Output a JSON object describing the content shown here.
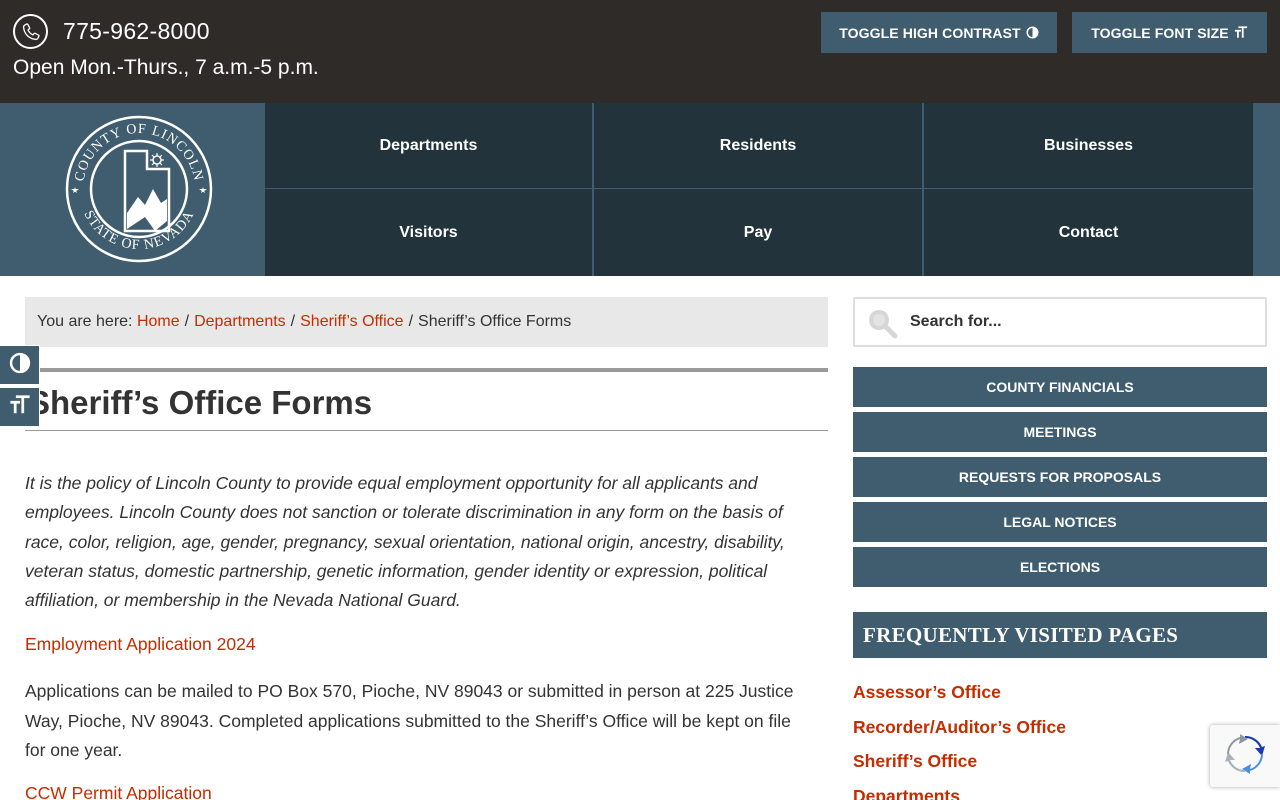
{
  "topbar": {
    "phone": "775-962-8000",
    "hours": "Open Mon.-Thurs., 7 a.m.-5 p.m.",
    "contrast_label": "TOGGLE HIGH CONTRAST",
    "font_label": "TOGGLE FONT SIZE"
  },
  "logo": {
    "top_text": "COUNTY OF LINCOLN",
    "bottom_text": "STATE OF NEVADA"
  },
  "nav": {
    "items": [
      {
        "label": "Departments"
      },
      {
        "label": "Residents"
      },
      {
        "label": "Businesses"
      },
      {
        "label": "Visitors"
      },
      {
        "label": "Pay"
      },
      {
        "label": "Contact"
      }
    ]
  },
  "breadcrumb": {
    "prefix": "You are here:",
    "links": [
      "Home",
      "Departments",
      "Sheriff’s Office"
    ],
    "current": "Sheriff’s Office Forms",
    "separator": "/"
  },
  "page": {
    "title": "Sheriff’s Office Forms",
    "policy": "It is the policy of Lincoln County to provide equal employment opportunity for all applicants and employees.  Lincoln County does not sanction or tolerate discrimination in any form on the basis of race, color, religion, age, gender, pregnancy, sexual orientation, national origin, ancestry, disability, veteran status, domestic partnership, genetic information, gender identity or expression, political affiliation, or membership in the Nevada National Guard.",
    "employment_link": "Employment Application 2024",
    "mail_text": "Applications can be mailed to PO Box 570, Pioche, NV 89043 or submitted in person at 225 Justice Way, Pioche, NV 89043.  Completed applications submitted to the Sheriff’s Office will be kept on file for one year.",
    "ccw_link": "CCW Permit Application"
  },
  "sidebar": {
    "search_placeholder": "Search for...",
    "buttons": [
      "COUNTY FINANCIALS",
      "MEETINGS",
      "REQUESTS FOR PROPOSALS",
      "LEGAL NOTICES",
      "ELECTIONS"
    ],
    "freq_title": "FREQUENTLY VISITED PAGES",
    "freq_items": [
      "Assessor’s Office",
      "Recorder/Auditor’s Office",
      "Sheriff’s Office",
      "Departments"
    ]
  },
  "colors": {
    "topbar_bg": "#2e2b29",
    "accent": "#3f5d6e",
    "nav_bg": "#22333c",
    "link": "#c52d00"
  },
  "icons": {
    "phone": "phone-icon",
    "contrast": "contrast-icon",
    "font_size": "font-size-icon",
    "search": "search-icon",
    "recaptcha": "recaptcha-icon"
  }
}
